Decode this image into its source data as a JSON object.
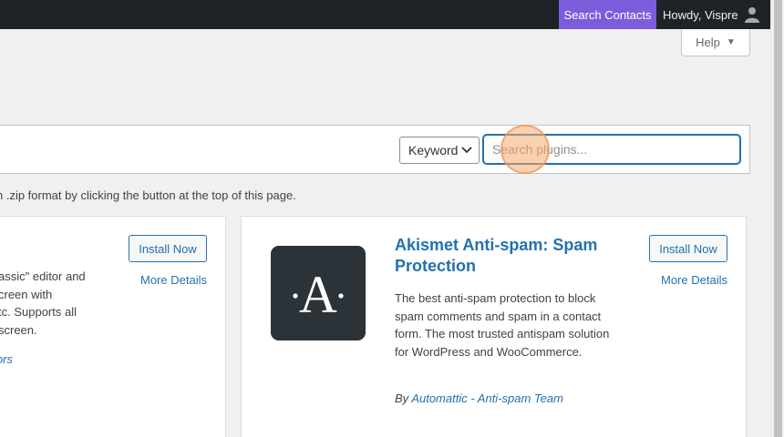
{
  "adminbar": {
    "search_contacts": "Search Contacts",
    "howdy": "Howdy, Vispre",
    "avatar_icon": "user-avatar-icon"
  },
  "help": {
    "label": "Help",
    "caret_icon": "caret-down-icon"
  },
  "filter": {
    "type_value": "Keyword",
    "search_placeholder": "Search plugins..."
  },
  "upload_note": "n .zip format by clicking the button at the top of this page.",
  "plugins": [
    {
      "install_label": "Install Now",
      "more_label": "More Details",
      "description_lines": [
        "assic\" editor and",
        "creen with",
        "tc. Supports all",
        "screen."
      ],
      "author_fragment": "ors"
    },
    {
      "icon": "akismet-logo-icon",
      "title": "Akismet Anti-spam: Spam Protection",
      "install_label": "Install Now",
      "more_label": "More Details",
      "description": "The best anti-spam protection to block spam comments and spam in a contact form. The most trusted antispam solution for WordPress and WooCommerce.",
      "by_label": "By",
      "author": "Automattic - Anti-spam Team"
    }
  ],
  "colors": {
    "adminbar_bg": "#1d2327",
    "search_contacts_bg": "#7d5cdb",
    "link": "#2271b1",
    "icon_bg": "#2c3338"
  }
}
